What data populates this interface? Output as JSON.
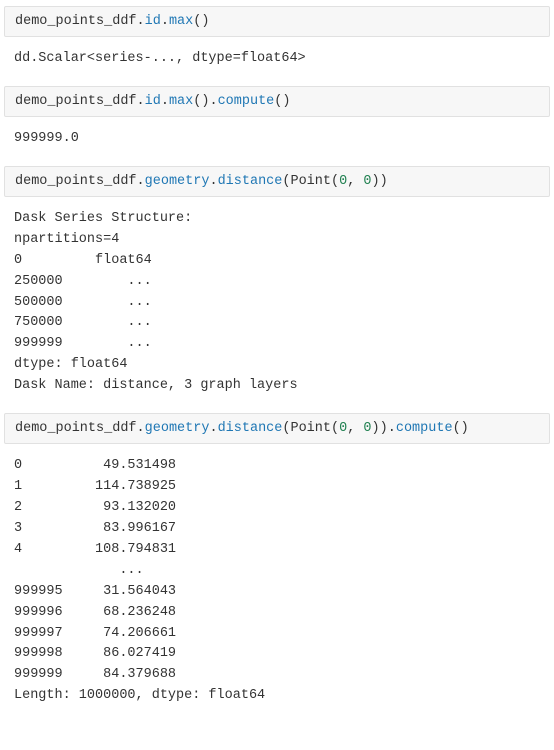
{
  "cell1": {
    "code": {
      "p0": "demo_points_ddf",
      "dot1": ".",
      "p1": "id",
      "dot2": ".",
      "p2": "max",
      "paren": "()"
    },
    "output": "dd.Scalar<series-..., dtype=float64>"
  },
  "cell2": {
    "code": {
      "p0": "demo_points_ddf",
      "dot1": ".",
      "p1": "id",
      "dot2": ".",
      "p2": "max",
      "paren1": "()",
      "dot3": ".",
      "p3": "compute",
      "paren2": "()"
    },
    "output": "999999.0"
  },
  "cell3": {
    "code": {
      "p0": "demo_points_ddf",
      "dot1": ".",
      "p1": "geometry",
      "dot2": ".",
      "p2": "distance",
      "open": "(",
      "ctor": "Point",
      "open2": "(",
      "n0": "0",
      "comma": ", ",
      "n1": "0",
      "close2": ")",
      "close": ")"
    },
    "output": "Dask Series Structure:\nnpartitions=4\n0         float64\n250000        ...\n500000        ...\n750000        ...\n999999        ...\ndtype: float64\nDask Name: distance, 3 graph layers"
  },
  "cell4": {
    "code": {
      "p0": "demo_points_ddf",
      "dot1": ".",
      "p1": "geometry",
      "dot2": ".",
      "p2": "distance",
      "open": "(",
      "ctor": "Point",
      "open2": "(",
      "n0": "0",
      "comma": ", ",
      "n1": "0",
      "close2": ")",
      "close": ")",
      "dot3": ".",
      "p3": "compute",
      "paren2": "()"
    },
    "output": "0          49.531498\n1         114.738925\n2          93.132020\n3          83.996167\n4         108.794831\n             ...\n999995     31.564043\n999996     68.236248\n999997     74.206661\n999998     86.027419\n999999     84.379688\nLength: 1000000, dtype: float64"
  }
}
